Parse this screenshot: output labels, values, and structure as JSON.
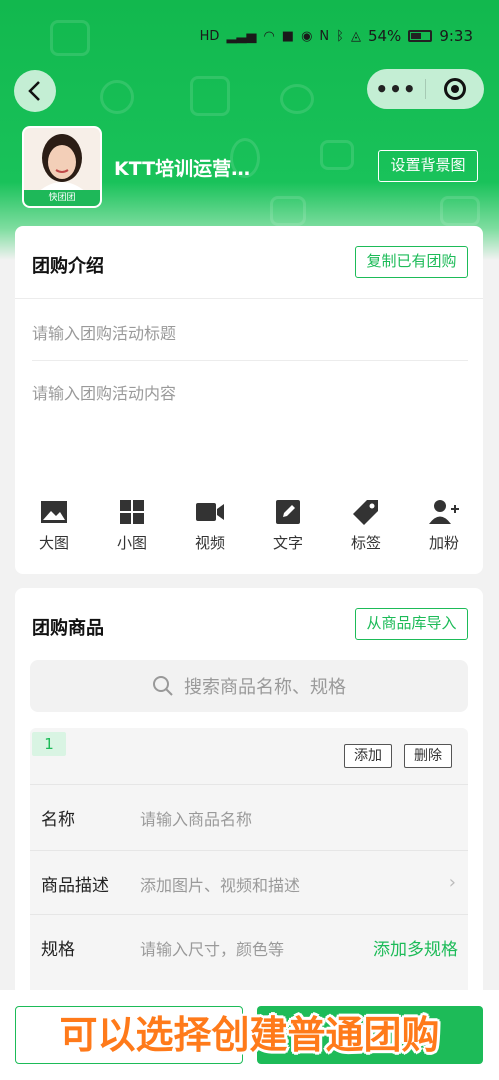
{
  "status_bar": {
    "battery": "54%",
    "time": "9:33",
    "icons": [
      "hd-icon",
      "signal-icon",
      "wifi-icon",
      "video-icon",
      "eye-icon",
      "nfc-icon",
      "bluetooth-icon",
      "mute-icon"
    ]
  },
  "header": {
    "store_name": "KTT培训运营…",
    "avatar_badge": "快团团",
    "set_background_label": "设置背景图",
    "theme_color": "#19c25a"
  },
  "intro": {
    "title": "团购介绍",
    "copy_button": "复制已有团购",
    "title_placeholder": "请输入团购活动标题",
    "content_placeholder": "请输入团购活动内容",
    "tools": [
      {
        "label": "大图",
        "icon": "image-large-icon"
      },
      {
        "label": "小图",
        "icon": "image-grid-icon"
      },
      {
        "label": "视频",
        "icon": "video-icon"
      },
      {
        "label": "文字",
        "icon": "edit-text-icon"
      },
      {
        "label": "标签",
        "icon": "tag-icon"
      },
      {
        "label": "加粉",
        "icon": "add-fans-icon"
      }
    ]
  },
  "goods": {
    "title": "团购商品",
    "import_button": "从商品库导入",
    "search_placeholder": "搜索商品名称、规格",
    "item_index": "1",
    "add_button": "添加",
    "delete_button": "删除",
    "name_label": "名称",
    "name_placeholder": "请输入商品名称",
    "desc_label": "商品描述",
    "desc_placeholder": "添加图片、视频和描述",
    "spec_label": "规格",
    "spec_placeholder": "请输入尺寸，颜色等",
    "multi_spec_link": "添加多规格"
  },
  "caption": "可以选择创建普通团购",
  "accent_color": "#1dbb58"
}
